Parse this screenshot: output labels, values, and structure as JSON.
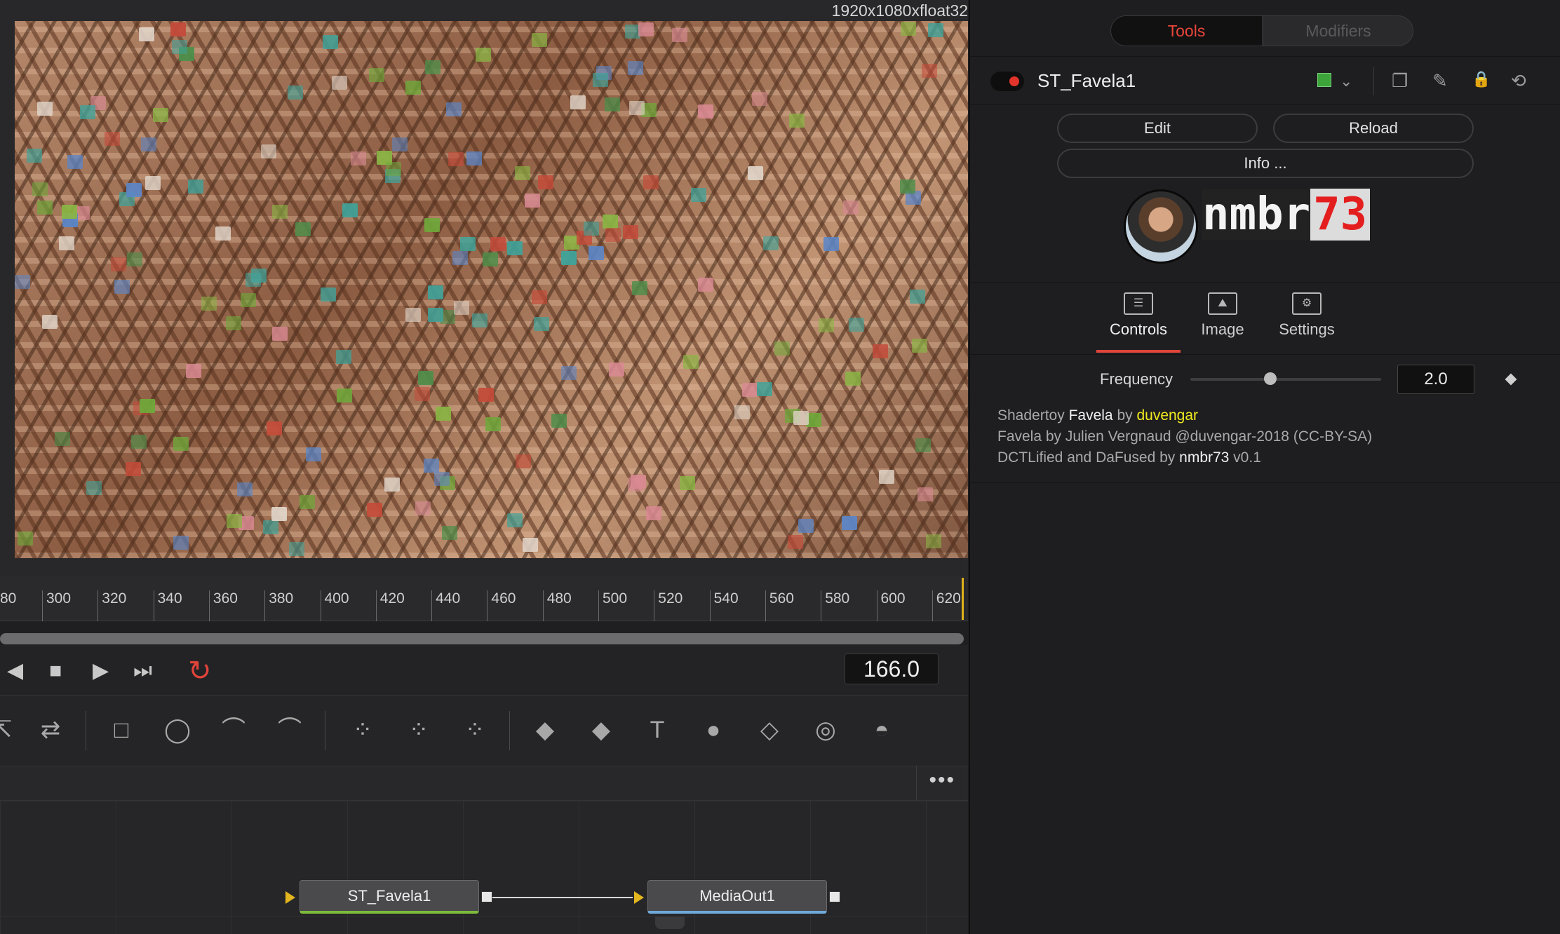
{
  "viewer": {
    "resolution": "1920x1080xfloat32"
  },
  "timeline": {
    "ticks": [
      "80",
      "300",
      "320",
      "340",
      "360",
      "380",
      "400",
      "420",
      "440",
      "460",
      "480",
      "500",
      "520",
      "540",
      "560",
      "580",
      "600",
      "620"
    ]
  },
  "transport": {
    "prev_icon": "◀",
    "stop_icon": "■",
    "play_icon": "▶",
    "end_icon": "⏭",
    "loop_icon": "↻",
    "current_time": "166.0"
  },
  "toolbar": {
    "icons": [
      "⇱",
      "⇄",
      "□",
      "◯",
      "⌒",
      "⌒",
      "⁘",
      "⁘",
      "⁘",
      "◆",
      "◆",
      "T",
      "●",
      "◇",
      "◎",
      "◓"
    ]
  },
  "nodebar": {
    "more": "•••"
  },
  "nodes": {
    "source": "ST_Favela1",
    "output": "MediaOut1"
  },
  "panel": {
    "seg": {
      "tools": "Tools",
      "modifiers": "Modifiers"
    },
    "tool_name": "ST_Favela1",
    "chip_color": "#3da43a",
    "header_icons": [
      "❐",
      "✎",
      "🔒",
      "⟲"
    ],
    "buttons": {
      "edit": "Edit",
      "reload": "Reload",
      "info": "Info ..."
    },
    "logo": {
      "text": "nmbr",
      "number": "73"
    },
    "tabs": {
      "controls": "Controls",
      "image": "Image",
      "settings": "Settings"
    },
    "frequency": {
      "label": "Frequency",
      "value": "2.0",
      "level": 0.42
    },
    "info": {
      "line1_prefix": "Shadertoy ",
      "line1_title": "Favela",
      "line1_by": " by ",
      "line1_author": "duvengar",
      "line2": "Favela by Julien Vergnaud @duvengar-2018 (CC-BY-SA)",
      "line3_prefix": "DCTLified and DaFused by ",
      "line3_author": "nmbr73",
      "line3_suffix": " v0.1"
    }
  }
}
